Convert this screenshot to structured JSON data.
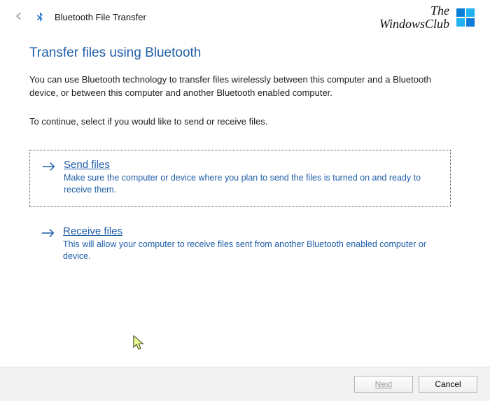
{
  "window": {
    "title": "Bluetooth File Transfer"
  },
  "watermark": {
    "line1": "The",
    "line2": "WindowsClub"
  },
  "page": {
    "heading": "Transfer files using Bluetooth",
    "intro": "You can use Bluetooth technology to transfer files wirelessly between this computer and a Bluetooth device, or between this computer and another Bluetooth enabled computer.",
    "prompt": "To continue, select if you would like to send or receive files."
  },
  "options": {
    "send": {
      "title": "Send files",
      "desc": "Make sure the computer or device where you plan to send the files is turned on and ready to receive them."
    },
    "receive": {
      "title": "Receive files",
      "desc": "This will allow your computer to receive files sent from another Bluetooth enabled computer or device."
    }
  },
  "footer": {
    "next": "Next",
    "cancel": "Cancel"
  }
}
